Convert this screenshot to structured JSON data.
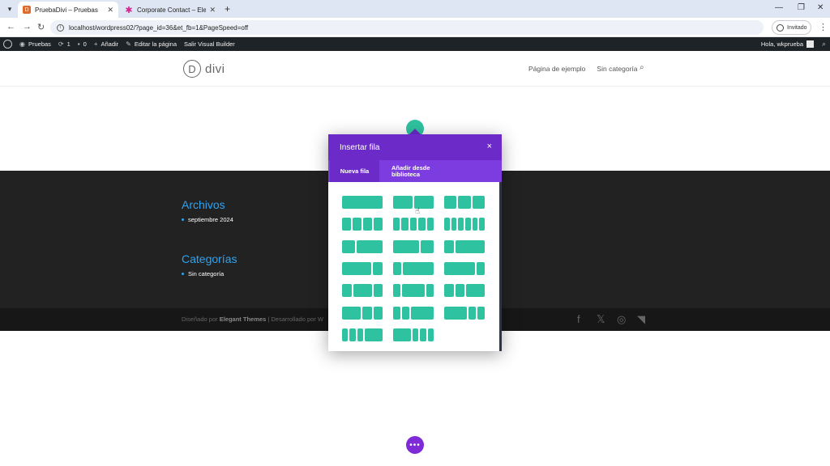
{
  "browser": {
    "tabs": [
      {
        "title": "PruebaDivi – Pruebas",
        "active": true
      },
      {
        "title": "Corporate Contact – Elegant Th",
        "active": false
      }
    ],
    "new_tab": "+",
    "url": "localhost/wordpress02/?page_id=36&et_fb=1&PageSpeed=off",
    "profile_label": "Invitado"
  },
  "wp_admin_bar": {
    "site_name": "Pruebas",
    "updates_count": "1",
    "comments_count": "0",
    "add_label": "Añadir",
    "edit_label": "Editar la página",
    "exit_label": "Salir Visual Builder",
    "greeting": "Hola, wkprueba"
  },
  "site_header": {
    "logo_letter": "D",
    "logo_text": "divi",
    "menu": [
      "Página de ejemplo",
      "Sin categoría"
    ]
  },
  "footer": {
    "widgets": [
      {
        "title": "Archivos",
        "item": "septiembre 2024"
      },
      {
        "title": "Categorías",
        "item": "Sin categoría"
      }
    ],
    "credits_prefix": "Diseñado por",
    "credits_brand": "Elegant Themes",
    "credits_suffix": "| Desarrollado por W"
  },
  "modal": {
    "title": "Insertar fila",
    "close": "×",
    "tabs": [
      "Nueva fila",
      "Añadir desde biblioteca"
    ],
    "layouts": [
      [
        1
      ],
      [
        1,
        1
      ],
      [
        1,
        1,
        1
      ],
      [
        1,
        1,
        1,
        1
      ],
      [
        1,
        1,
        1,
        1,
        1
      ],
      [
        1,
        1,
        1,
        1,
        1,
        1
      ],
      [
        1,
        2
      ],
      [
        2,
        1
      ],
      [
        1,
        3
      ],
      [
        3,
        1
      ],
      [
        1,
        4
      ],
      [
        4,
        1
      ],
      [
        1,
        2,
        1
      ],
      [
        1,
        3,
        1
      ],
      [
        1,
        1,
        2
      ],
      [
        2,
        1,
        1
      ],
      [
        1,
        1,
        3
      ],
      [
        3,
        1,
        1
      ],
      [
        1,
        1,
        1,
        3
      ],
      [
        3,
        1,
        1,
        1
      ]
    ]
  },
  "colors": {
    "accent_purple": "#6c2bc9",
    "layout_green": "#2ec2a0",
    "footer_bg": "#222222",
    "widget_title": "#2ea3f2"
  }
}
